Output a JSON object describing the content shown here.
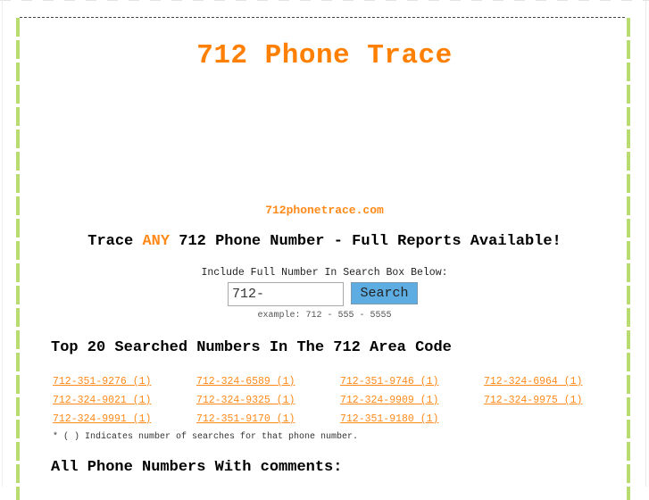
{
  "site": {
    "title": "712 Phone Trace",
    "domain": "712phonetrace.com"
  },
  "tagline": {
    "prefix": "Trace ",
    "accent": "ANY",
    "suffix": " 712 Phone Number - Full Reports Available!"
  },
  "search": {
    "instructions": "Include Full Number In Search Box Below:",
    "input_value": "712-",
    "button_label": "Search",
    "example": "example: 712 - 555 - 5555"
  },
  "top_searched": {
    "heading": "Top 20 Searched Numbers In The 712 Area Code",
    "numbers": [
      "712-351-9276 (1)",
      "712-324-6589 (1)",
      "712-351-9746 (1)",
      "712-324-6964 (1)",
      "712-324-9021 (1)",
      "712-324-9325 (1)",
      "712-324-9909 (1)",
      "712-324-9975 (1)",
      "712-324-9991 (1)",
      "712-351-9170 (1)",
      "712-351-9180 (1)"
    ],
    "footnote": "* ( ) Indicates number of searches for that phone number."
  },
  "comments_section": {
    "heading": "All Phone Numbers With comments:"
  },
  "colors": {
    "accent_orange": "#ff7f00",
    "border_green": "#b8dc70",
    "button_blue": "#5dade2"
  }
}
